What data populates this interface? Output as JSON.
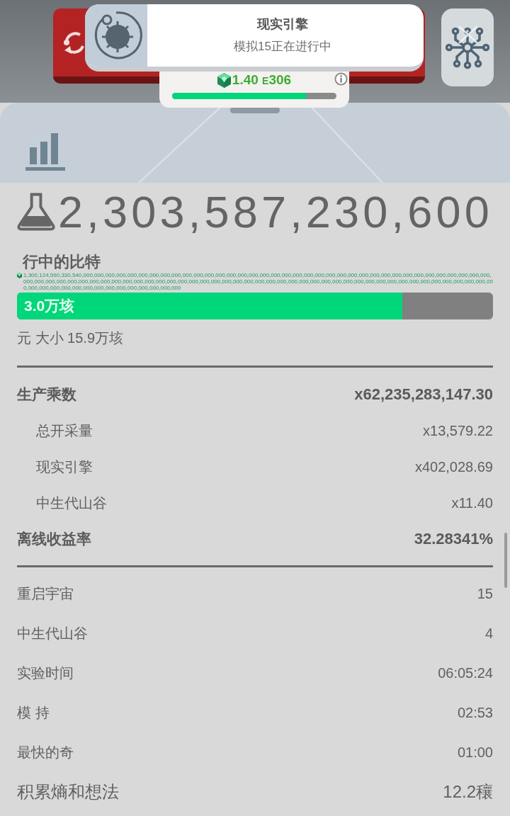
{
  "notification": {
    "title": "现实引擎",
    "message": "模拟15正在进行中"
  },
  "currency": {
    "mantissa": "1.40",
    "exponent_letter": "E",
    "exponent": "306",
    "level": 0.82
  },
  "total": "2,303,587,230,600",
  "bits": {
    "label": "行中的比特",
    "full_value": "1,300,124,590,330,540,000,000,000,000,000,000,000,000,000,000,000,000,000,000,000,000,000,000,000,000,000,000,000,000,000,000,000,000,000,000,000,000,000,000,000,000,000,000,000,000,000,000,000,000,000,000,000,000,000,000,000,000,000,000,000,000,000,000,000,000,000,000,000,000,000,000,000,000,000,000,000,000,000,000,000,000,000,000,000,000,000,000,000,000,000,000,000,000,000,000,000,000,000,000",
    "bar_text": "3.0万垓",
    "level": 0.81,
    "size": "元 大小 15.9万垓"
  },
  "multipliers": [
    {
      "kind": "total",
      "label": "生产乘数",
      "value": "x62,235,283,147.30"
    },
    {
      "kind": "part",
      "label": "总开采量",
      "value": "x13,579.22"
    },
    {
      "kind": "part",
      "label": "现实引擎",
      "value": "x402,028.69"
    },
    {
      "kind": "part",
      "label": "中生代山谷",
      "value": "x11.40"
    },
    {
      "kind": "total",
      "label": "离线收益率",
      "value": "32.28341%"
    }
  ],
  "stats": [
    {
      "kind": "normal",
      "label": "重启宇宙",
      "value": "15"
    },
    {
      "kind": "normal",
      "label": "中生代山谷",
      "value": "4"
    },
    {
      "kind": "normal",
      "label": "实验时间",
      "value": "06:05:24"
    },
    {
      "kind": "normal",
      "label": "模 持",
      "value": "02:53"
    },
    {
      "kind": "normal",
      "label": "最快的奇",
      "value": "01:00"
    },
    {
      "kind": "large",
      "label": "积累熵和想法",
      "value": "12.2穰"
    }
  ]
}
